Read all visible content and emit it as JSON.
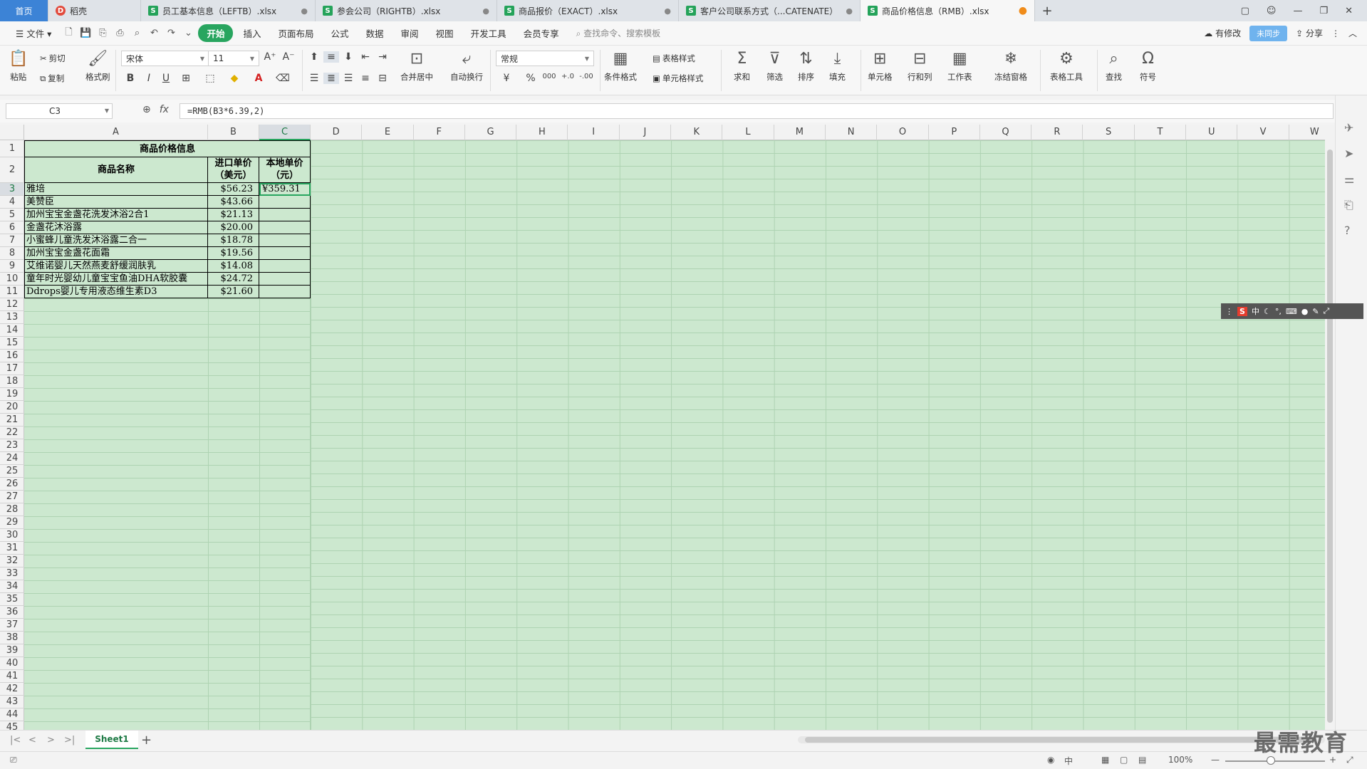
{
  "tabs": [
    {
      "label": "首页",
      "type": "home"
    },
    {
      "label": "稻壳",
      "type": "docer"
    },
    {
      "label": "员工基本信息（LEFTB）.xlsx",
      "type": "sheet"
    },
    {
      "label": "参会公司（RIGHTB）.xlsx",
      "type": "sheet"
    },
    {
      "label": "商品报价（EXACT）.xlsx",
      "type": "sheet"
    },
    {
      "label": "客户公司联系方式（...CATENATE）",
      "type": "sheet"
    },
    {
      "label": "商品价格信息（RMB）.xlsx",
      "type": "sheet",
      "active": true
    }
  ],
  "menu": {
    "file": "文件",
    "items": [
      "开始",
      "插入",
      "页面布局",
      "公式",
      "数据",
      "审阅",
      "视图",
      "开发工具",
      "会员专享"
    ],
    "active": "开始",
    "search_placeholder": "查找命令、搜索模板",
    "right": {
      "changes": "有修改",
      "cloud": "未同步",
      "share": "分享"
    }
  },
  "ribbon": {
    "paste": "粘贴",
    "cut": "剪切",
    "copy": "复制",
    "format_painter": "格式刷",
    "font_name": "宋体",
    "font_size": "11",
    "merge_center": "合并居中",
    "wrap_text": "自动换行",
    "number_format": "常规",
    "conditional_format": "条件格式",
    "table_style": "表格样式",
    "cell_style": "单元格样式",
    "sum": "求和",
    "filter": "筛选",
    "sort": "排序",
    "fill": "填充",
    "cell": "单元格",
    "row_col": "行和列",
    "worksheet": "工作表",
    "freeze": "冻结窗格",
    "table_tools": "表格工具",
    "find": "查找",
    "symbol": "符号"
  },
  "formula_bar": {
    "name_box": "C3",
    "formula": "=RMB(B3*6.39,2)"
  },
  "columns": [
    "A",
    "B",
    "C",
    "D",
    "E",
    "F",
    "G",
    "H",
    "I",
    "J",
    "K",
    "L",
    "M",
    "N",
    "O",
    "P",
    "Q",
    "R",
    "S",
    "T",
    "U",
    "V",
    "W"
  ],
  "sheet": {
    "title": "商品价格信息",
    "headers": [
      "商品名称",
      "进口单价（美元）",
      "本地单价（元）"
    ],
    "rows": [
      {
        "name": "雅培",
        "usd": "$56.23",
        "rmb": "¥359.31"
      },
      {
        "name": "美赞臣",
        "usd": "$43.66",
        "rmb": ""
      },
      {
        "name": "加州宝宝金盏花洗发沐浴2合1",
        "usd": "$21.13",
        "rmb": ""
      },
      {
        "name": "金盏花沐浴露",
        "usd": "$20.00",
        "rmb": ""
      },
      {
        "name": "小蜜蜂儿童洗发沐浴露二合一",
        "usd": "$18.78",
        "rmb": ""
      },
      {
        "name": "加州宝宝金盏花面霜",
        "usd": "$19.56",
        "rmb": ""
      },
      {
        "name": "艾维诺婴儿天然燕麦舒缓润肤乳",
        "usd": "$14.08",
        "rmb": ""
      },
      {
        "name": "童年时光婴幼儿童宝宝鱼油DHA软胶囊",
        "usd": "$24.72",
        "rmb": ""
      },
      {
        "name": "Ddrops婴儿专用液态维生素D3",
        "usd": "$21.60",
        "rmb": ""
      }
    ]
  },
  "sheet_tabs": [
    "Sheet1"
  ],
  "status": {
    "zoom": "100%"
  },
  "watermark": "最需教育"
}
